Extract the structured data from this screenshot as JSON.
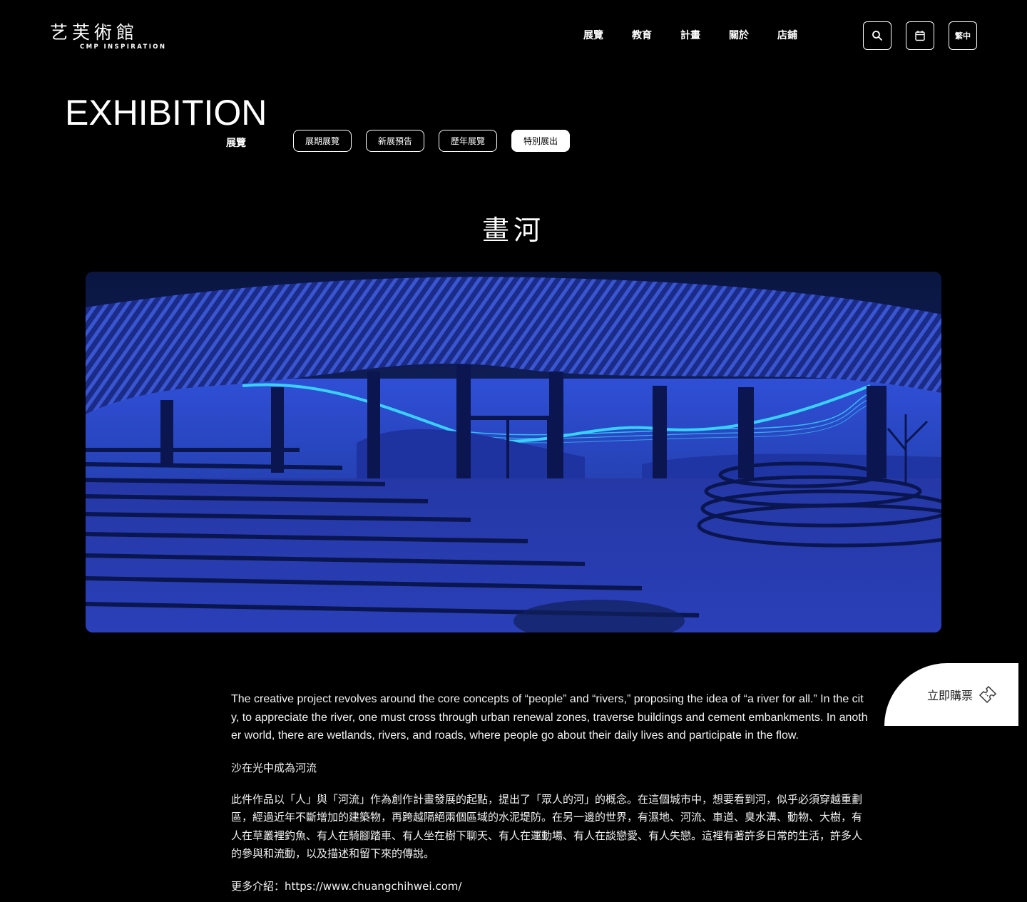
{
  "header": {
    "logo_text": "艺芙術館",
    "logo_sub": "CMP INSPIRATION",
    "nav": [
      "展覽",
      "教育",
      "計畫",
      "關於",
      "店鋪"
    ],
    "lang_label": "繁中"
  },
  "page": {
    "title": "EXHIBITION",
    "subtitle": "展覽",
    "tabs": [
      {
        "label": "展期展覽",
        "active": false
      },
      {
        "label": "新展預告",
        "active": false
      },
      {
        "label": "歷年展覽",
        "active": false
      },
      {
        "label": "特別展出",
        "active": true
      }
    ]
  },
  "exhibition": {
    "title": "畫河",
    "description_en": "The creative project revolves around the core concepts of “people” and “rivers,” proposing the idea of “a river for all.” In the city, to appreciate the river, one must cross through urban renewal zones, traverse buildings and cement embankments. In another world, there are wetlands, rivers, and roads, where people go about their daily lives and participate in the flow.",
    "subtitle_cn": "沙在光中成為河流",
    "description_cn": "此件作品以「人」與「河流」作為創作計畫發展的起點，提出了「眾人的河」的概念。在這個城市中，想要看到河，似乎必須穿越重劃區，經過近年不斷增加的建築物，再跨越隔絕兩個區域的水泥堤防。在另一邊的世界，有濕地、河流、車道、臭水溝、動物、大樹，有人在草叢裡釣魚、有人在騎腳踏車、有人坐在樹下聊天、有人在運動場、有人在談戀愛、有人失戀。這裡有著許多日常的生活，許多人的參與和流動，以及描述和留下來的傳說。",
    "more_label": "更多介紹：",
    "more_url": "https://www.chuangchihwei.com/"
  },
  "buy": {
    "label": "立即購票"
  },
  "icons": {
    "search": "search-icon",
    "calendar": "calendar-icon",
    "ticket": "ticket-icon"
  },
  "colors": {
    "background": "#000000",
    "hero_blue": "#2a44b8",
    "neon": "#3ad8ff"
  }
}
